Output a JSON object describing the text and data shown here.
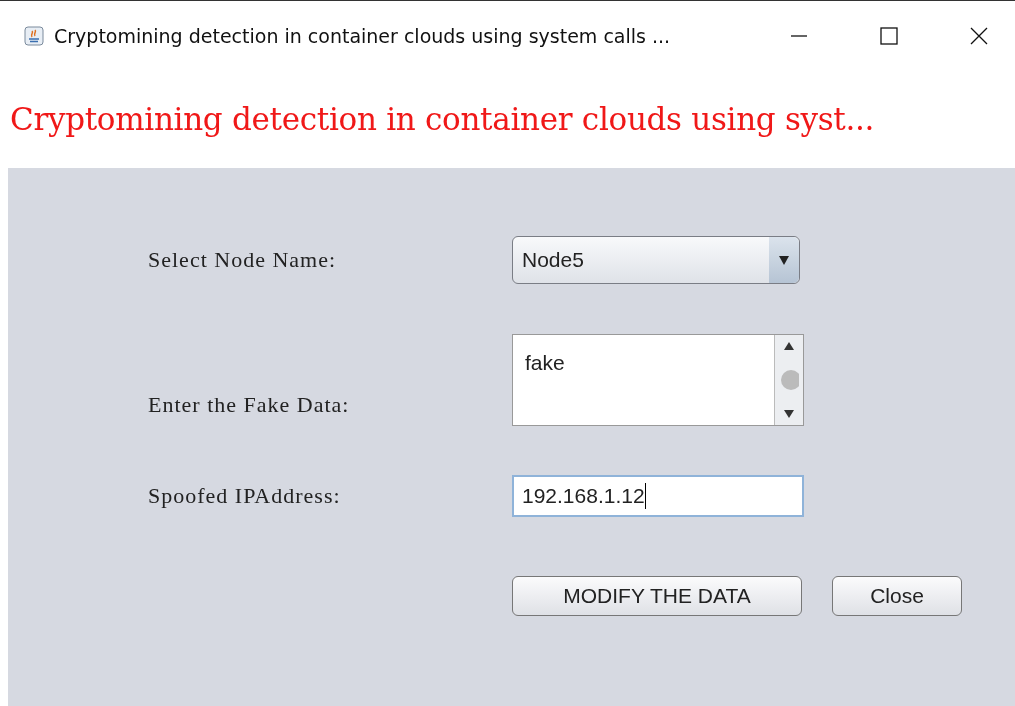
{
  "window": {
    "title": "Cryptomining detection in container clouds using system calls ..."
  },
  "banner": {
    "text": "Cryptomining detection in container clouds using syst..."
  },
  "form": [
    {
      "kind": "combo",
      "label": "Select Node Name:",
      "value": "Node5"
    },
    {
      "kind": "textarea",
      "label": "Enter the Fake Data:",
      "value": "fake"
    },
    {
      "kind": "text",
      "label": "Spoofed IPAddress:",
      "value": "192.168.1.12"
    }
  ],
  "buttons": [
    "MODIFY THE DATA",
    "Close"
  ]
}
